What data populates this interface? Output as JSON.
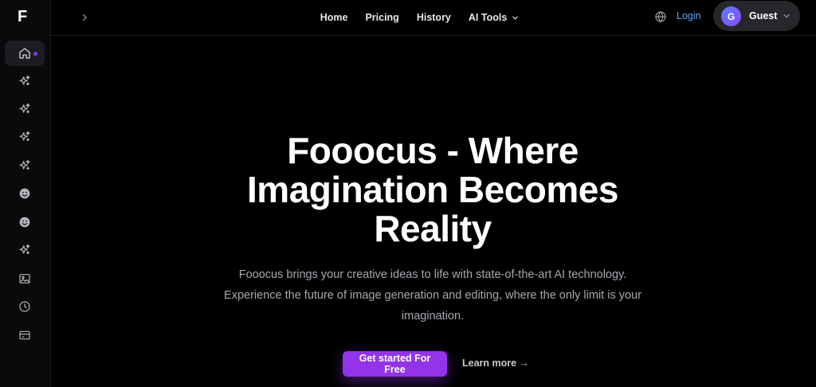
{
  "app": {
    "logo_letter": "F"
  },
  "colors": {
    "accent": "#9333ea",
    "link": "#60a5fa",
    "icon": "#a1a1aa"
  },
  "sidebar": {
    "items": [
      {
        "icon": "home-icon",
        "active": true
      },
      {
        "icon": "sparkles-icon"
      },
      {
        "icon": "sparkles-icon"
      },
      {
        "icon": "sparkles-icon"
      },
      {
        "icon": "sparkles-icon"
      },
      {
        "icon": "smiley-icon"
      },
      {
        "icon": "smiley-icon"
      },
      {
        "icon": "sparkles-icon"
      },
      {
        "icon": "image-icon"
      },
      {
        "icon": "clock-icon"
      },
      {
        "icon": "credit-card-icon"
      }
    ]
  },
  "nav": {
    "home": "Home",
    "pricing": "Pricing",
    "history": "History",
    "ai_tools": "AI Tools"
  },
  "header": {
    "login": "Login",
    "user": {
      "initial": "G",
      "name": "Guest"
    }
  },
  "hero": {
    "title": "Fooocus - Where Imagination Becomes Reality",
    "subtitle": "Fooocus brings your creative ideas to life with state-of-the-art AI technology. Experience the future of image generation and editing, where the only limit is your imagination.",
    "cta_primary": "Get started For Free",
    "cta_secondary": "Learn more →"
  }
}
